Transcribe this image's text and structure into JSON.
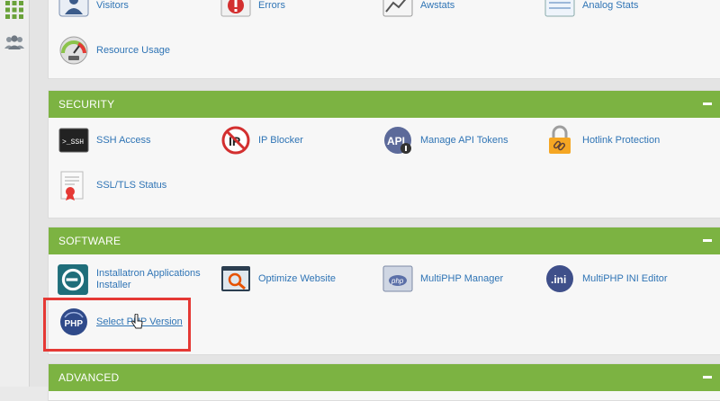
{
  "left_sidebar": {
    "icons": [
      "grid-icon",
      "users-icon"
    ]
  },
  "metrics": {
    "items": [
      {
        "label": "Visitors",
        "icon": "visitors-icon"
      },
      {
        "label": "Errors",
        "icon": "errors-icon"
      },
      {
        "label": "Awstats",
        "icon": "awstats-icon"
      },
      {
        "label": "Analog Stats",
        "icon": "analog-stats-icon"
      },
      {
        "label": "Resource Usage",
        "icon": "resource-usage-icon"
      }
    ]
  },
  "security": {
    "title": "SECURITY",
    "items": [
      {
        "label": "SSH Access",
        "icon": "ssh-icon",
        "icon_text": ">_SSH"
      },
      {
        "label": "IP Blocker",
        "icon": "ip-blocker-icon",
        "icon_text": "IP"
      },
      {
        "label": "Manage API Tokens",
        "icon": "api-icon",
        "icon_text": "API"
      },
      {
        "label": "Hotlink Protection",
        "icon": "padlock-chain-icon"
      },
      {
        "label": "SSL/TLS Status",
        "icon": "certificate-icon"
      }
    ]
  },
  "software": {
    "title": "SOFTWARE",
    "items": [
      {
        "label": "Installatron Applications Installer",
        "icon": "installatron-icon"
      },
      {
        "label": "Optimize Website",
        "icon": "optimize-icon"
      },
      {
        "label": "MultiPHP Manager",
        "icon": "multiphp-icon",
        "icon_text": "php"
      },
      {
        "label": "MultiPHP INI Editor",
        "icon": "ini-editor-icon",
        "icon_text": ".ini"
      },
      {
        "label": "Select PHP Version",
        "icon": "php-icon",
        "icon_text": "PHP"
      }
    ]
  },
  "advanced": {
    "title": "ADVANCED"
  },
  "colors": {
    "header_green": "#7cb342",
    "link_blue": "#2f74b5",
    "highlight_red": "#e53935"
  }
}
